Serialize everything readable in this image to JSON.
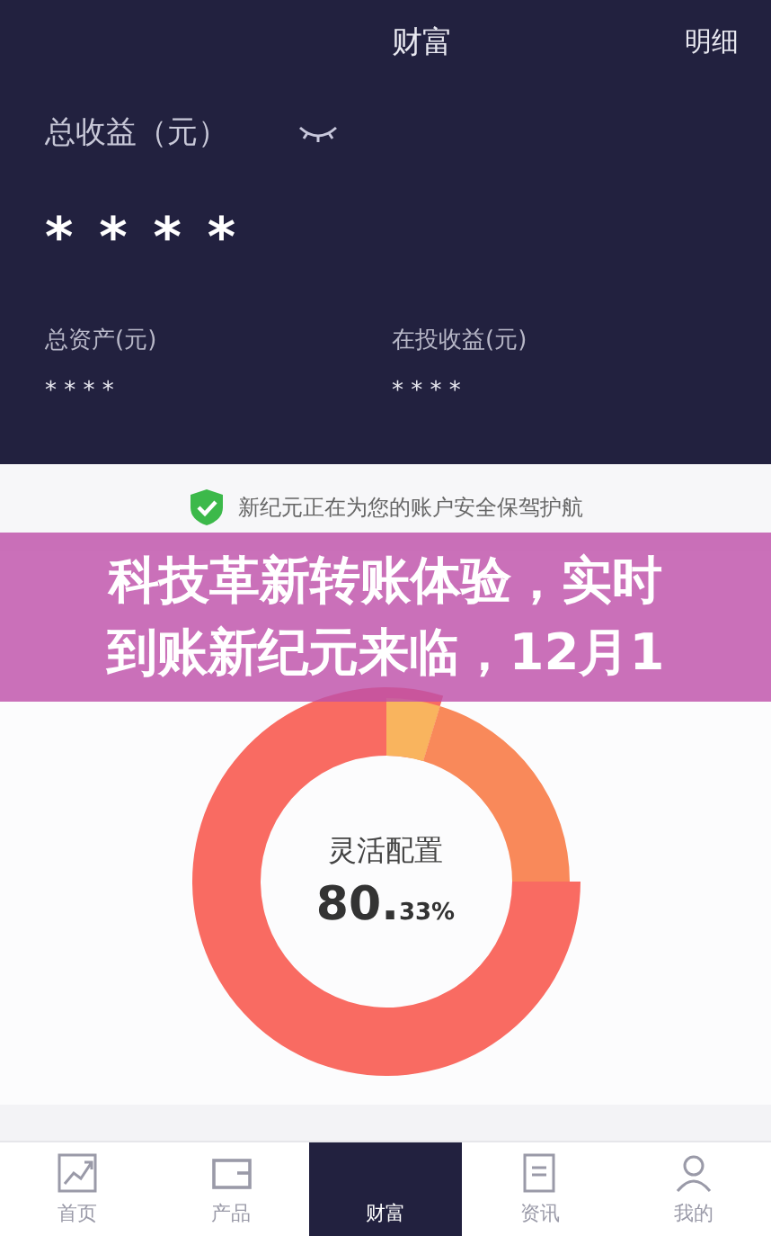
{
  "header": {
    "title": "财富",
    "action": "明细"
  },
  "total_income": {
    "label": "总收益（元）",
    "value": "* * * *",
    "hidden": true
  },
  "stats": [
    {
      "label": "总资产(元)",
      "value": "* * * *"
    },
    {
      "label": "在投收益(元)",
      "value": "* * * *"
    }
  ],
  "security_note": "新纪元正在为您的账户安全保驾护航",
  "allocation": {
    "label": "灵活配置",
    "value": "80.",
    "decimal": "33%"
  },
  "overlay": {
    "lines": [
      "科技革新转账体验，实时",
      "到账新纪元来临，12月1"
    ]
  },
  "tabs": [
    {
      "label": "首页",
      "kind": "chart",
      "selected": false
    },
    {
      "label": "产品",
      "kind": "box",
      "selected": false
    },
    {
      "label": "财富",
      "kind": "plain",
      "selected": true
    },
    {
      "label": "资讯",
      "kind": "doc",
      "selected": false
    },
    {
      "label": "我的",
      "kind": "person",
      "selected": false
    }
  ]
}
